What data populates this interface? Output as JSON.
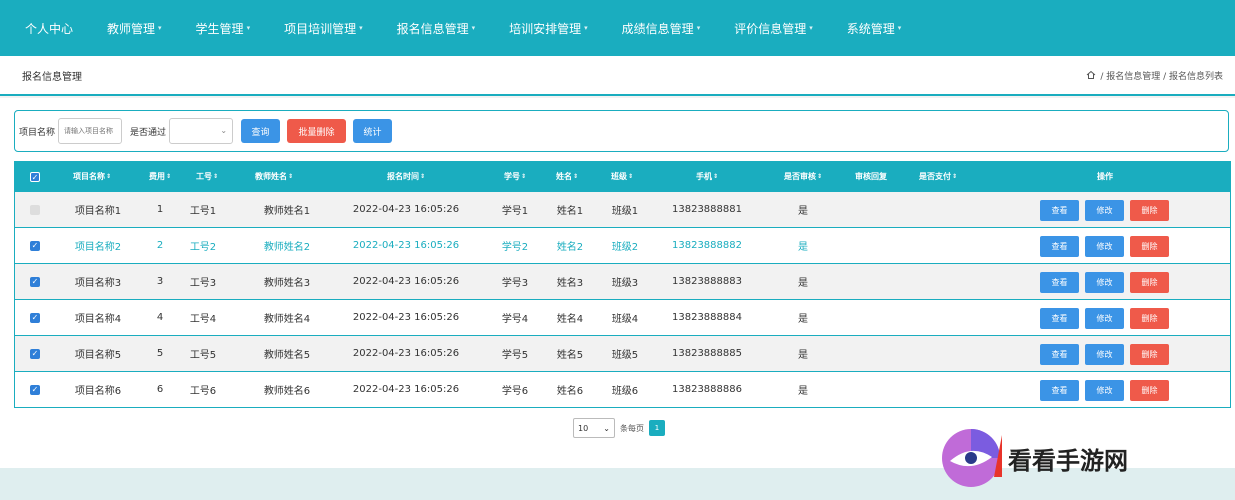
{
  "nav": [
    {
      "label": "个人中心",
      "dropdown": false
    },
    {
      "label": "教师管理",
      "dropdown": true
    },
    {
      "label": "学生管理",
      "dropdown": true
    },
    {
      "label": "项目培训管理",
      "dropdown": true
    },
    {
      "label": "报名信息管理",
      "dropdown": true
    },
    {
      "label": "培训安排管理",
      "dropdown": true
    },
    {
      "label": "成绩信息管理",
      "dropdown": true
    },
    {
      "label": "评价信息管理",
      "dropdown": true
    },
    {
      "label": "系统管理",
      "dropdown": true
    }
  ],
  "page": {
    "title": "报名信息管理",
    "breadcrumb": "/ 报名信息管理 / 报名信息列表"
  },
  "search": {
    "project_label": "项目名称",
    "project_placeholder": "请输入项目名称",
    "passed_label": "是否通过",
    "query_btn": "查询",
    "batch_delete_btn": "批量删除",
    "stats_btn": "统计"
  },
  "table": {
    "headers": [
      "项目名称",
      "费用",
      "工号",
      "教师姓名",
      "报名时间",
      "学号",
      "姓名",
      "班级",
      "手机",
      "是否审核",
      "审核回复",
      "是否支付",
      "操作"
    ],
    "rows": [
      {
        "project": "项目名称1",
        "fee": "1",
        "job_no": "工号1",
        "teacher": "教师姓名1",
        "time": "2022-04-23 16:05:26",
        "student_no": "学号1",
        "name": "姓名1",
        "class": "班级1",
        "phone": "13823888881",
        "audited": "是",
        "reply": "",
        "paid": "",
        "checked": false
      },
      {
        "project": "项目名称2",
        "fee": "2",
        "job_no": "工号2",
        "teacher": "教师姓名2",
        "time": "2022-04-23 16:05:26",
        "student_no": "学号2",
        "name": "姓名2",
        "class": "班级2",
        "phone": "13823888882",
        "audited": "是",
        "reply": "",
        "paid": "",
        "checked": true
      },
      {
        "project": "项目名称3",
        "fee": "3",
        "job_no": "工号3",
        "teacher": "教师姓名3",
        "time": "2022-04-23 16:05:26",
        "student_no": "学号3",
        "name": "姓名3",
        "class": "班级3",
        "phone": "13823888883",
        "audited": "是",
        "reply": "",
        "paid": "",
        "checked": true
      },
      {
        "project": "项目名称4",
        "fee": "4",
        "job_no": "工号4",
        "teacher": "教师姓名4",
        "time": "2022-04-23 16:05:26",
        "student_no": "学号4",
        "name": "姓名4",
        "class": "班级4",
        "phone": "13823888884",
        "audited": "是",
        "reply": "",
        "paid": "",
        "checked": true
      },
      {
        "project": "项目名称5",
        "fee": "5",
        "job_no": "工号5",
        "teacher": "教师姓名5",
        "time": "2022-04-23 16:05:26",
        "student_no": "学号5",
        "name": "姓名5",
        "class": "班级5",
        "phone": "13823888885",
        "audited": "是",
        "reply": "",
        "paid": "",
        "checked": true
      },
      {
        "project": "项目名称6",
        "fee": "6",
        "job_no": "工号6",
        "teacher": "教师姓名6",
        "time": "2022-04-23 16:05:26",
        "student_no": "学号6",
        "name": "姓名6",
        "class": "班级6",
        "phone": "13823888886",
        "audited": "是",
        "reply": "",
        "paid": "",
        "checked": true
      }
    ],
    "actions": {
      "view": "查看",
      "edit": "修改",
      "delete": "删除"
    }
  },
  "pager": {
    "page_size": "10",
    "per_page_label": "条每页",
    "current_page": "1"
  },
  "watermark": {
    "text": "看看手游网"
  },
  "colors": {
    "primary": "#1aadbf",
    "blue_button": "#3b94e6",
    "red_button": "#ef5a4a"
  },
  "icons": {
    "home": "home-icon",
    "sort": "sort-icon",
    "dropdown": "chevron-down-icon",
    "checkbox": "checkbox-icon"
  }
}
